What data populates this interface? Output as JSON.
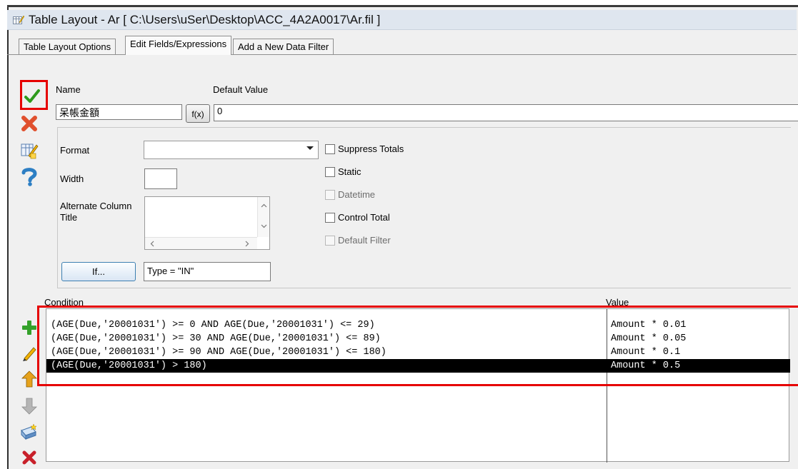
{
  "window": {
    "title": "Table Layout - Ar [ C:\\Users\\uSer\\Desktop\\ACC_4A2A0017\\Ar.fil ]"
  },
  "tabs": [
    {
      "label": "Table Layout Options"
    },
    {
      "label": "Edit Fields/Expressions"
    },
    {
      "label": "Add a New Data Filter"
    }
  ],
  "toolbar": {
    "icons": [
      "checkmark-icon",
      "close-icon",
      "edit-table-icon",
      "help-icon",
      "add-icon",
      "pencil-icon",
      "arrow-up-icon",
      "arrow-down-icon",
      "paste-icon",
      "delete-icon"
    ]
  },
  "form": {
    "name_label": "Name",
    "name_value": "呆帳金額",
    "default_label": "Default Value",
    "fx_label": "f(x)",
    "default_value": "0",
    "format_label": "Format",
    "format_value": "",
    "width_label": "Width",
    "width_value": "",
    "alt_title_label_1": "Alternate Column",
    "alt_title_label_2": "Title",
    "alt_title_value": "",
    "if_label": "If...",
    "if_value": "Type = \"IN\"",
    "checkboxes": {
      "suppress_totals": "Suppress Totals",
      "static": "Static",
      "datetime": "Datetime",
      "control_total": "Control Total",
      "default_filter": "Default Filter"
    }
  },
  "grid": {
    "condition_header": "Condition",
    "value_header": "Value",
    "rows": [
      {
        "condition": "(AGE(Due,'20001031') >= 0 AND AGE(Due,'20001031') <= 29)",
        "value": "Amount * 0.01",
        "selected": false
      },
      {
        "condition": "(AGE(Due,'20001031') >= 30 AND AGE(Due,'20001031') <= 89)",
        "value": "Amount * 0.05",
        "selected": false
      },
      {
        "condition": "(AGE(Due,'20001031') >= 90 AND AGE(Due,'20001031') <= 180)",
        "value": "Amount * 0.1",
        "selected": false
      },
      {
        "condition": "(AGE(Due,'20001031') > 180)",
        "value": "Amount * 0.5",
        "selected": true
      }
    ]
  },
  "colors": {
    "highlight": "#e60000",
    "selected_row_bg": "#000000",
    "titlebar_bg": "#dfe6ef"
  }
}
